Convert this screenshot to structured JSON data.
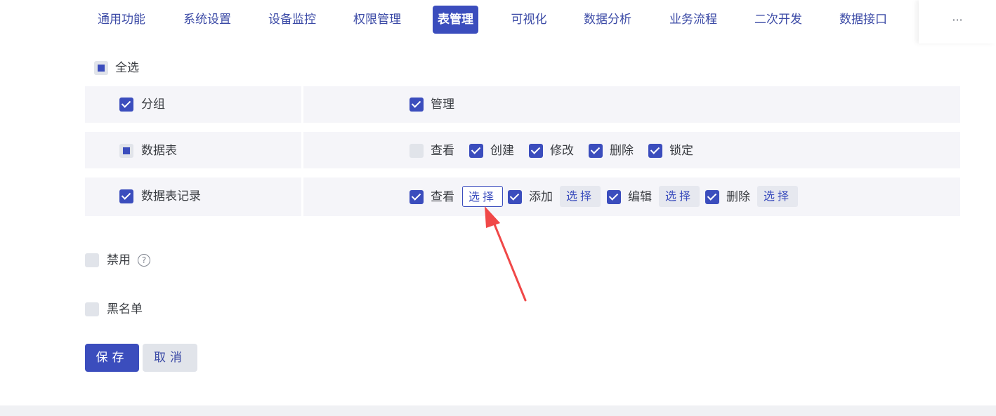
{
  "nav": {
    "tabs": [
      "通用功能",
      "系统设置",
      "设备监控",
      "权限管理",
      "表管理",
      "可视化",
      "数据分析",
      "业务流程",
      "二次开发",
      "数据接口"
    ],
    "active": "表管理",
    "more": "···"
  },
  "select_all": "全选",
  "rows": {
    "group": {
      "label": "分组",
      "perm_manage": "管理"
    },
    "table": {
      "label": "数据表",
      "view": "查看",
      "create": "创建",
      "edit": "修改",
      "delete": "删除",
      "lock": "锁定"
    },
    "record": {
      "label": "数据表记录",
      "view": "查看",
      "add": "添加",
      "edit": "编辑",
      "delete": "删除",
      "select": "选择"
    }
  },
  "options": {
    "disable": "禁用",
    "help": "?",
    "blacklist": "黑名单"
  },
  "actions": {
    "save": "保存",
    "cancel": "取消"
  },
  "colors": {
    "accent": "#3b4dbd",
    "arrow": "#f04848"
  }
}
